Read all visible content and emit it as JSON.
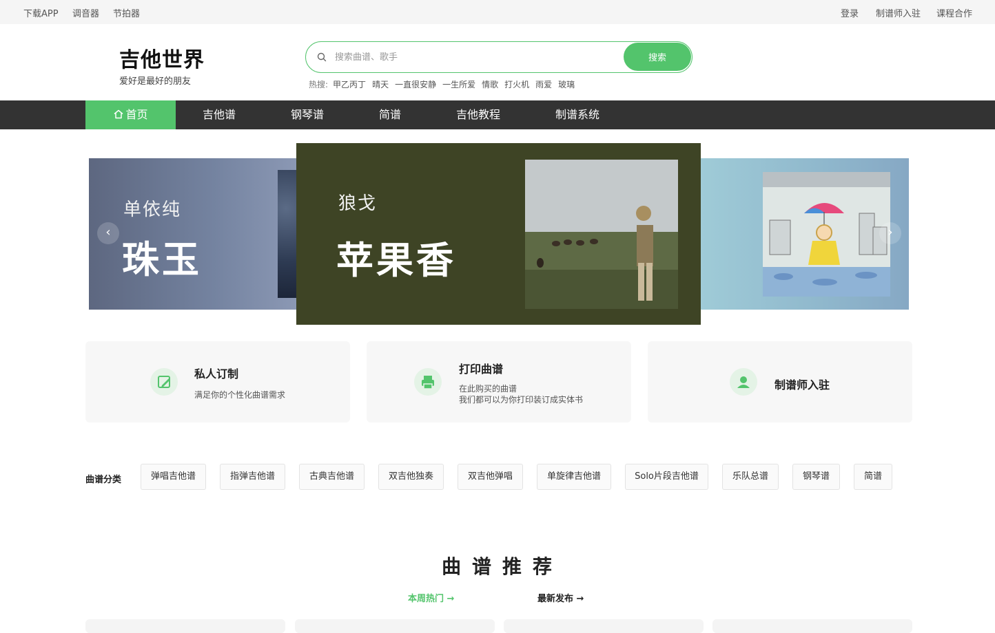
{
  "topbar": {
    "left_links": [
      "下载APP",
      "调音器",
      "节拍器"
    ],
    "right_links": [
      "登录",
      "制谱师入驻",
      "课程合作"
    ]
  },
  "header": {
    "logo_title": "吉他世界",
    "logo_subtitle": "爱好是最好的朋友",
    "search": {
      "placeholder": "搜索曲谱、歌手",
      "button_label": "搜索",
      "icon": "search-icon"
    },
    "hot_label": "热搜:",
    "hot_terms": [
      "甲乙丙丁",
      "晴天",
      "一直很安静",
      "一生所爱",
      "情歌",
      "打火机",
      "雨爱",
      "玻璃"
    ]
  },
  "nav": {
    "items": [
      "首页",
      "吉他谱",
      "钢琴谱",
      "简谱",
      "吉他教程",
      "制谱系统"
    ],
    "active_index": 0,
    "home_icon": "home-icon"
  },
  "carousel": {
    "slides": [
      {
        "artist": "单依纯",
        "title": "珠玉"
      },
      {
        "artist": "狼戈",
        "title": "苹果香"
      }
    ],
    "prev_icon": "chevron-left-icon",
    "next_icon": "chevron-right-icon"
  },
  "services": [
    {
      "title": "私人订制",
      "desc": [
        "满足你的个性化曲谱需求"
      ],
      "icon": "edit-pencil-icon"
    },
    {
      "title": "打印曲谱",
      "desc": [
        "在此购买的曲谱",
        "我们都可以为你打印装订成实体书"
      ],
      "icon": "printer-icon"
    },
    {
      "title": "制谱师入驻",
      "desc": [],
      "icon": "user-icon"
    }
  ],
  "categories": {
    "label": "曲谱分类",
    "items": [
      "弹唱吉他谱",
      "指弹吉他谱",
      "古典吉他谱",
      "双吉他独奏",
      "双吉他弹唱",
      "单旋律吉他谱",
      "Solo片段吉他谱",
      "乐队总谱",
      "钢琴谱",
      "简谱"
    ]
  },
  "recommend": {
    "title": "曲谱推荐",
    "tabs": [
      "本周热门 →",
      "最新发布 →"
    ]
  },
  "colors": {
    "accent": "#53c46c",
    "nav_bg": "#333333",
    "topbar_bg": "#f5f5f5"
  }
}
